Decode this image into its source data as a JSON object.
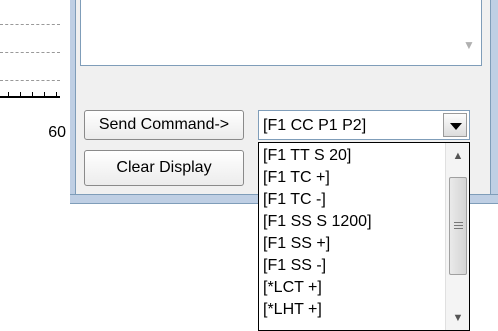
{
  "chart": {
    "axis_tick_label": "60"
  },
  "buttons": {
    "send_command": "Send Command->",
    "clear_display": "Clear Display"
  },
  "command_combo": {
    "selected": "[F1 CC P1 P2]",
    "options": [
      "[F1 TT S 20]",
      "[F1 TC +]",
      "[F1 TC -]",
      "[F1 SS S 1200]",
      "[F1 SS +]",
      "[F1 SS -]",
      "[*LCT +]",
      "[*LHT +]"
    ]
  },
  "icons": {
    "combo_arrow": "chevron-down-icon",
    "list_scroll_up": "scroll-up-arrow-icon",
    "list_scroll_down": "scroll-down-arrow-icon",
    "display_scroll_down": "scroll-down-arrow-icon"
  },
  "colors": {
    "frame": "#bfcfe4",
    "frame_border": "#7f9db9",
    "panel": "#f0f0f0"
  }
}
